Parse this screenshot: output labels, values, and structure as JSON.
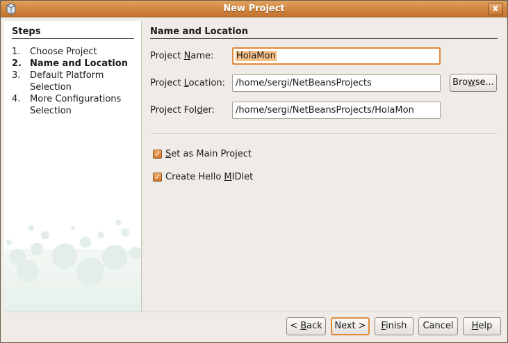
{
  "window": {
    "title": "New Project",
    "close_label": "x"
  },
  "steps": {
    "title": "Steps",
    "items": [
      {
        "num": "1.",
        "label": "Choose Project"
      },
      {
        "num": "2.",
        "label": "Name and Location"
      },
      {
        "num": "3.",
        "label": "Default Platform Selection"
      },
      {
        "num": "4.",
        "label": "More Configurations Selection"
      }
    ]
  },
  "section": {
    "title": "Name and Location"
  },
  "fields": {
    "project_name": {
      "label_pre": "Project ",
      "label_mn": "N",
      "label_post": "ame:",
      "value": "HolaMon"
    },
    "project_location": {
      "label_pre": "Project ",
      "label_mn": "L",
      "label_post": "ocation:",
      "value": "/home/sergi/NetBeansProjects"
    },
    "project_folder": {
      "label_pre": "Project Fol",
      "label_mn": "d",
      "label_post": "er:",
      "value": "/home/sergi/NetBeansProjects/HolaMon"
    }
  },
  "browse_button": {
    "pre": "Bro",
    "mn": "w",
    "post": "se..."
  },
  "options": {
    "main_project": {
      "pre": "",
      "mn": "S",
      "post": "et as Main Project",
      "checked": true
    },
    "hello_midlet": {
      "pre": "Create Hello ",
      "mn": "M",
      "post": "IDlet",
      "checked": true
    }
  },
  "buttons": {
    "back": {
      "pre": "< ",
      "mn": "B",
      "post": "ack"
    },
    "next": {
      "label": "Next >"
    },
    "finish": {
      "pre": "",
      "mn": "F",
      "post": "inish"
    },
    "cancel": {
      "label": "Cancel"
    },
    "help": {
      "pre": "",
      "mn": "H",
      "post": "elp"
    }
  },
  "colors": {
    "titlebar": "#d38a42",
    "accent": "#e0893c",
    "panel": "#efebe7"
  }
}
